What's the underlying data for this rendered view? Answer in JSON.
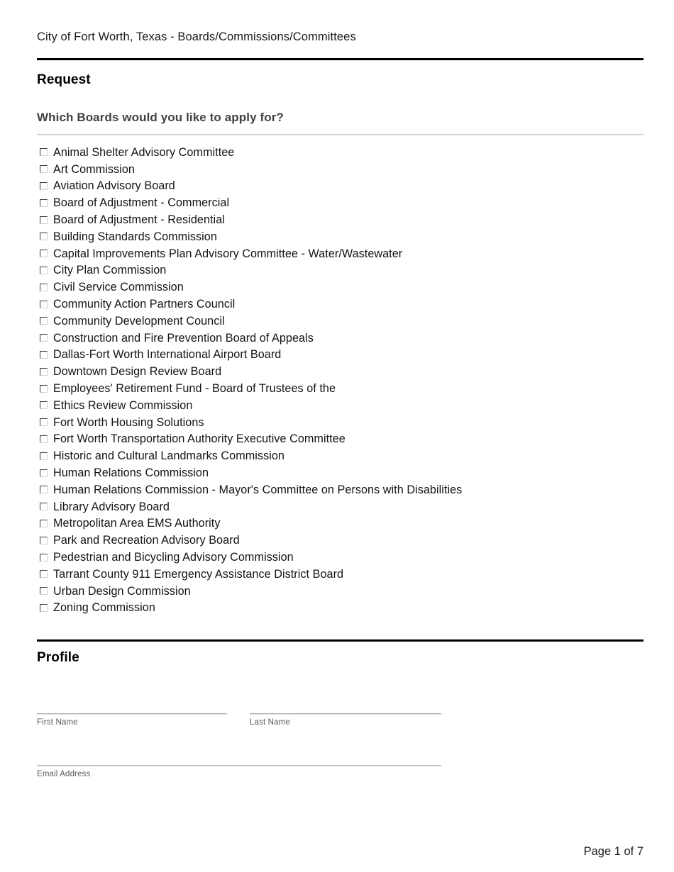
{
  "document": {
    "header_title": "City of Fort Worth, Texas - Boards/Commissions/Committees",
    "footer_page": "Page 1 of 7"
  },
  "request_section": {
    "title": "Request",
    "question": "Which Boards would you like to apply for?",
    "options": [
      "Animal Shelter Advisory Committee",
      "Art Commission",
      "Aviation Advisory Board",
      "Board of Adjustment - Commercial",
      "Board of Adjustment - Residential",
      "Building Standards Commission",
      "Capital Improvements Plan Advisory Committee - Water/Wastewater",
      "City Plan Commission",
      "Civil Service Commission",
      "Community Action Partners Council",
      "Community Development Council",
      "Construction and Fire Prevention Board of Appeals",
      "Dallas-Fort Worth International Airport Board",
      "Downtown Design Review Board",
      "Employees' Retirement Fund - Board of Trustees of the",
      "Ethics Review Commission",
      "Fort Worth Housing Solutions",
      "Fort Worth Transportation Authority Executive Committee",
      "Historic and Cultural Landmarks Commission",
      "Human Relations Commission",
      "Human Relations Commission - Mayor's Committee on Persons with Disabilities",
      "Library Advisory Board",
      "Metropolitan Area EMS Authority",
      "Park and Recreation Advisory Board",
      "Pedestrian and Bicycling Advisory Commission",
      "Tarrant County 911 Emergency Assistance District Board",
      "Urban Design Commission",
      "Zoning Commission"
    ]
  },
  "profile_section": {
    "title": "Profile",
    "fields": [
      {
        "label": "First Name",
        "value": ""
      },
      {
        "label": "Last Name",
        "value": ""
      },
      {
        "label": "Email Address",
        "value": ""
      }
    ]
  },
  "colors": {
    "rule_dark": "#000000",
    "rule_light": "#c9c9c9",
    "text_primary": "#141414",
    "text_muted": "#5a5a5a",
    "question_text": "#414141"
  }
}
